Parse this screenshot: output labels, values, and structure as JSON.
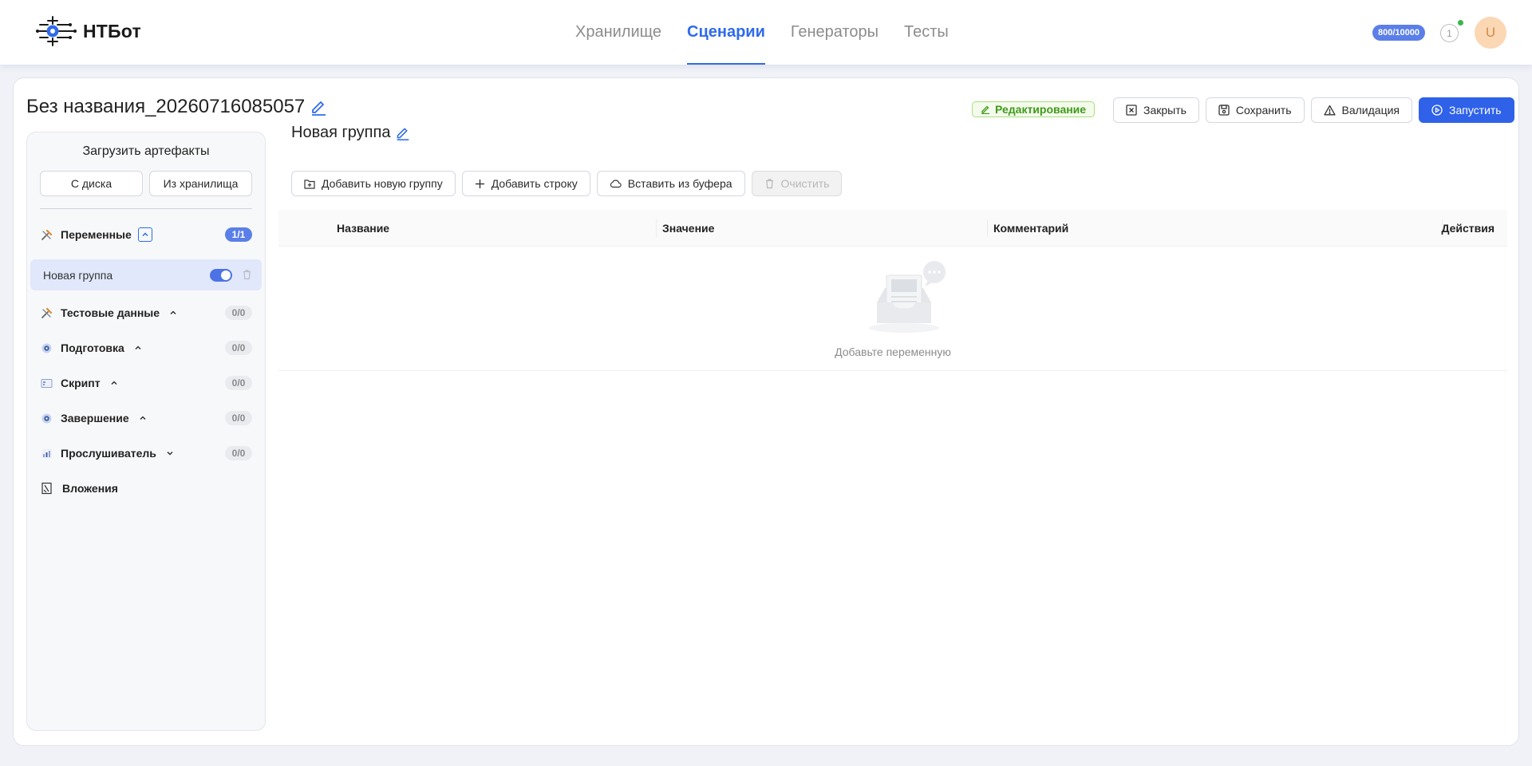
{
  "app": {
    "name": "НТБот",
    "nav": [
      {
        "label": "Хранилище",
        "active": false
      },
      {
        "label": "Сценарии",
        "active": true
      },
      {
        "label": "Генераторы",
        "active": false
      },
      {
        "label": "Тесты",
        "active": false
      }
    ],
    "quota": "800/10000",
    "notifications": "1",
    "avatar": "U",
    "accent": "#2f6bea"
  },
  "scenario": {
    "title": "Без названия_20260716085057",
    "mode_badge": "Редактирование",
    "actions": {
      "close": "Закрыть",
      "save": "Сохранить",
      "validate": "Валидация",
      "run": "Запустить"
    }
  },
  "sidebar": {
    "title": "Загрузить артефакты",
    "from_disk": "С диска",
    "from_storage": "Из хранилища",
    "sections": [
      {
        "label": "Переменные",
        "count": "1/1",
        "icon": "tools-icon",
        "expanded": true
      },
      {
        "label": "Тестовые данные",
        "count": "0/0",
        "icon": "tools-icon",
        "expanded": true
      },
      {
        "label": "Подготовка",
        "count": "0/0",
        "icon": "eye-gear-icon",
        "expanded": true
      },
      {
        "label": "Скрипт",
        "count": "0/0",
        "icon": "script-icon",
        "expanded": true
      },
      {
        "label": "Завершение",
        "count": "0/0",
        "icon": "eye-gear-icon",
        "expanded": true
      },
      {
        "label": "Прослушиватель",
        "count": "0/0",
        "icon": "chart-icon",
        "expanded": false
      },
      {
        "label": "Вложения",
        "icon": "attachment-icon"
      }
    ],
    "group_item": {
      "label": "Новая группа",
      "enabled": true
    }
  },
  "content": {
    "group_title": "Новая группа",
    "toolbar": {
      "add_group": "Добавить новую группу",
      "add_row": "Добавить строку",
      "paste": "Вставить из буфера",
      "clear": "Очистить"
    },
    "columns": [
      "Название",
      "Значение",
      "Комментарий",
      "Действия"
    ],
    "empty_text": "Добавьте переменную"
  }
}
